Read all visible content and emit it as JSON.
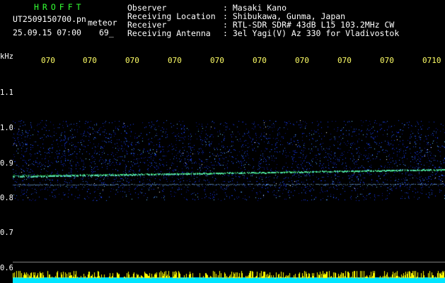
{
  "header": {
    "logo_text": "HROFFT",
    "filename": "UT2509150700.pn",
    "mode": "meteor",
    "date_time": "25.09.15 07:00",
    "count": "69_",
    "fields": [
      {
        "label": "Observer",
        "value": ": Masaki Kano"
      },
      {
        "label": "Receiving Location",
        "value": ": Shibukawa, Gunma, Japan"
      },
      {
        "label": "Receiver",
        "value": ": RTL-SDR SDR# 43dB L15 103.2MHz CW"
      },
      {
        "label": "Receiving Antenna",
        "value": ": 3el Yagi(V) Az 330 for Vladivostok"
      }
    ]
  },
  "axis": {
    "unit_label": "kHz",
    "y_labels": [
      "1.1",
      "1.0",
      "0.9",
      "0.8",
      "0.7",
      "0.6"
    ],
    "x_labels": [
      "070",
      "070",
      "070",
      "070",
      "070",
      "070",
      "070",
      "070",
      "070",
      "0710"
    ]
  },
  "colors": {
    "background": "#000000",
    "noise_blue": "#1a3cff",
    "trace_green": "#33ff66",
    "level_yellow": "#ffff00",
    "level_cyan": "#00e5ff"
  }
}
